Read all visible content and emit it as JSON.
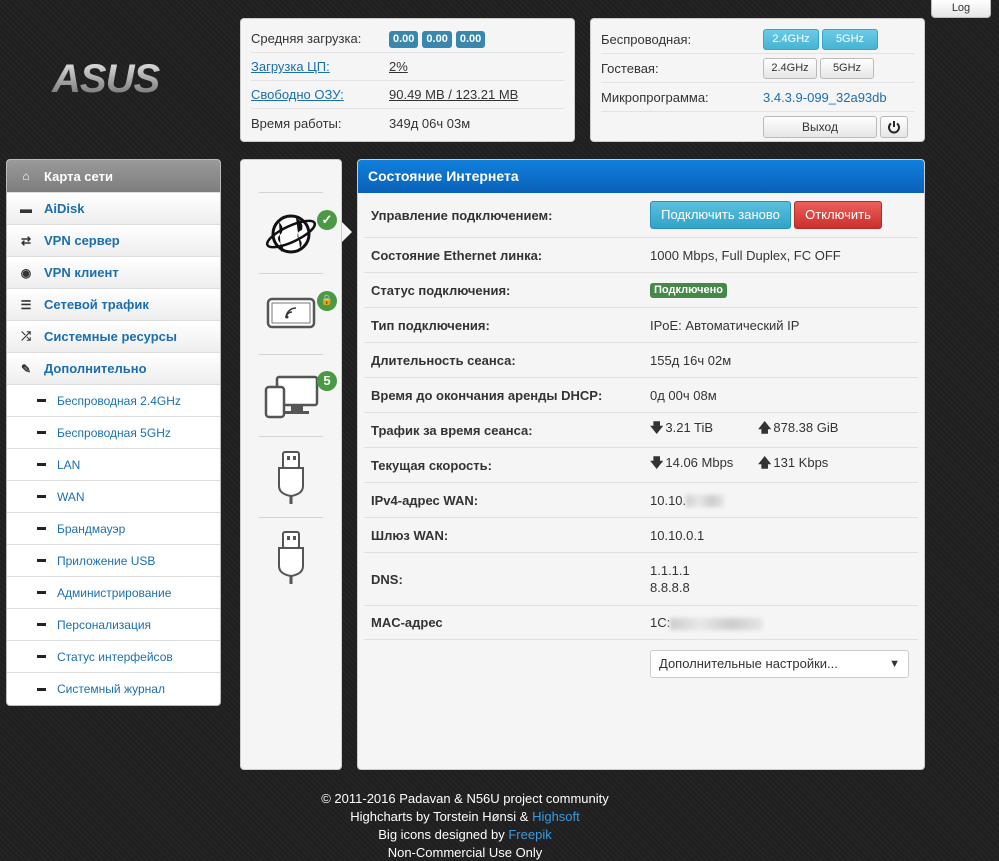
{
  "top": {
    "log_label": "Log"
  },
  "logo": {
    "text": "ASUS"
  },
  "system": {
    "load_label": "Средняя загрузка:",
    "load_values": [
      "0.00",
      "0.00",
      "0.00"
    ],
    "cpu_label": "Загрузка ЦП:",
    "cpu_value": "2%",
    "ram_label": "Свободно ОЗУ:",
    "ram_value": "90.49 MB / 123.21 MB",
    "uptime_label": "Время работы:",
    "uptime_value": "349д 06ч 03м"
  },
  "wireless": {
    "wireless_label": "Беспроводная:",
    "guest_label": "Гостевая:",
    "band_24": "2.4GHz",
    "band_5": "5GHz",
    "firmware_label": "Микропрограмма:",
    "firmware_value": "3.4.3.9-099_32a93db",
    "exit_label": "Выход"
  },
  "sidebar": {
    "items": [
      {
        "label": "Карта сети",
        "icon": "home-icon",
        "glyph": "⌂"
      },
      {
        "label": "AiDisk",
        "icon": "hdd-icon",
        "glyph": "▬"
      },
      {
        "label": "VPN сервер",
        "icon": "retweet-icon",
        "glyph": "⇄"
      },
      {
        "label": "VPN клиент",
        "icon": "globe-icon",
        "glyph": "◉"
      },
      {
        "label": "Сетевой трафик",
        "icon": "tasks-icon",
        "glyph": "☰"
      },
      {
        "label": "Системные ресурсы",
        "icon": "random-icon",
        "glyph": "⤮"
      },
      {
        "label": "Дополнительно",
        "icon": "wrench-icon",
        "glyph": "✎"
      }
    ],
    "subitems": [
      "Беспроводная 2.4GHz",
      "Беспроводная 5GHz",
      "LAN",
      "WAN",
      "Брандмауэр",
      "Приложение USB",
      "Администрирование",
      "Персонализация",
      "Статус интерфейсов",
      "Системный журнал"
    ]
  },
  "icons": {
    "clients_count": "5"
  },
  "internet": {
    "title": "Состояние Интернета",
    "rows": {
      "control_label": "Управление подключением:",
      "reconnect_label": "Подключить заново",
      "disconnect_label": "Отключить",
      "eth_label": "Состояние Ethernet линка:",
      "eth_value": "1000 Mbps, Full Duplex, FC OFF",
      "status_label": "Статус подключения:",
      "status_value": "Подключено",
      "type_label": "Тип подключения:",
      "type_value": "IPoE: Автоматический IP",
      "session_label": "Длительность сеанса:",
      "session_value": "155д 16ч 02м",
      "lease_label": "Время до окончания аренды DHCP:",
      "lease_value": "0д 00ч 08м",
      "traffic_label": "Трафик за время сеанса:",
      "traffic_down": "3.21 TiB",
      "traffic_up": "878.38 GiB",
      "speed_label": "Текущая скорость:",
      "speed_down": "14.06 Mbps",
      "speed_up": "131 Kbps",
      "ipv4_label": "IPv4-адрес WAN:",
      "ipv4_value": "10.10.",
      "gw_label": "Шлюз WAN:",
      "gw_value": "10.10.0.1",
      "dns_label": "DNS:",
      "dns1": "1.1.1.1",
      "dns2": "8.8.8.8",
      "mac_label": "MAC-адрес",
      "mac_value": "1C:"
    },
    "more_settings": "Дополнительные настройки..."
  },
  "footer": {
    "line1": "© 2011-2016 Padavan & N56U project community",
    "line2_prefix": "Highcharts by Torstein Hønsi & ",
    "line2_link": "Highsoft",
    "line3_prefix": "Big icons designed by ",
    "line3_link": "Freepik",
    "line4": "Non-Commercial Use Only"
  }
}
